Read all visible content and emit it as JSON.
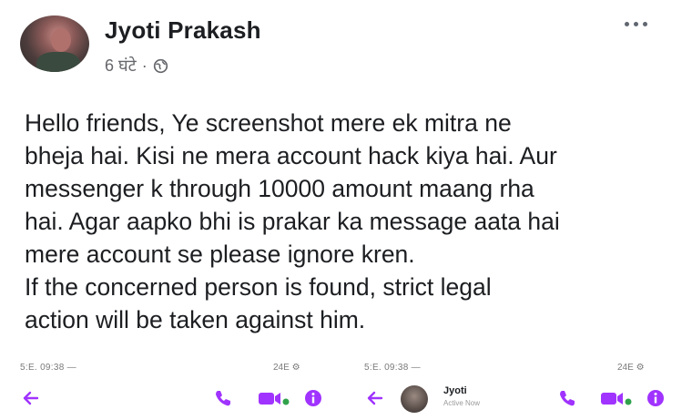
{
  "post": {
    "author": "Jyoti Prakash",
    "time": "6 घंटे",
    "separator": "·",
    "audience_icon": "globe-icon",
    "more_icon": "more-options-icon",
    "lines": [
      "Hello friends, Ye screenshot mere ek mitra ne",
      "bheja hai. Kisi ne mera account hack kiya hai. Aur",
      "messenger k through 10000 amount maang rha",
      "hai. Agar aapko bhi is prakar ka message aata hai",
      "mere account se please ignore kren.",
      "If the concerned person is found, strict legal",
      "action will be taken against him."
    ]
  },
  "screenshots": {
    "left": {
      "status_left": "5:E. 09:38 —",
      "status_right": "24E ⚙",
      "icons": [
        "back-arrow-icon",
        "phone-icon",
        "video-icon",
        "info-icon"
      ]
    },
    "right": {
      "status_left": "5:E. 09:38 —",
      "status_right": "24E ⚙",
      "contact_name": "Jyoti",
      "contact_status": "Active Now",
      "icons": [
        "back-arrow-icon",
        "phone-icon",
        "video-icon",
        "info-icon"
      ]
    }
  },
  "colors": {
    "messenger_accent": "#a033ff",
    "online_dot": "#31a24c",
    "text": "#1c1e21",
    "muted": "#65676b"
  }
}
